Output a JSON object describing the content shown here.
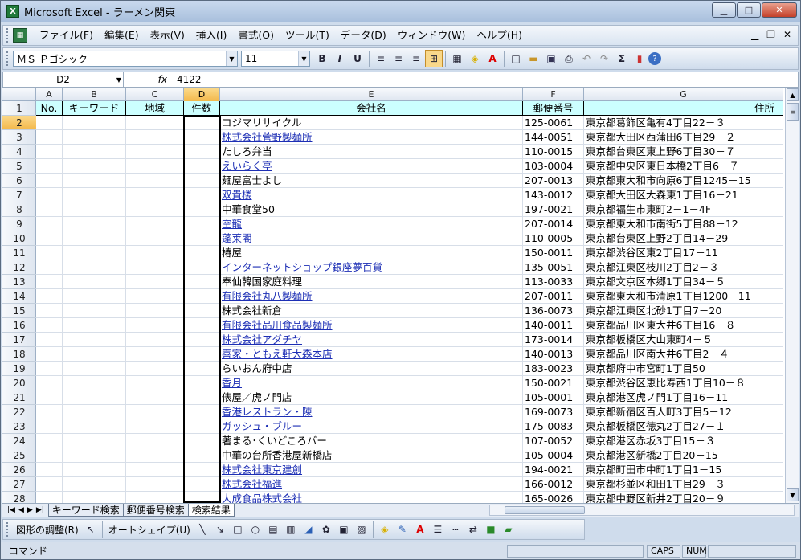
{
  "window": {
    "title": "Microsoft Excel - ラーメン関東"
  },
  "menu": [
    "ファイル(F)",
    "編集(E)",
    "表示(V)",
    "挿入(I)",
    "書式(O)",
    "ツール(T)",
    "データ(D)",
    "ウィンドウ(W)",
    "ヘルプ(H)"
  ],
  "toolbar": {
    "font": "ＭＳ Ｐゴシック",
    "size": "11",
    "bold": "B",
    "italic": "I",
    "underline": "U",
    "sigma": "Σ"
  },
  "formula": {
    "cell_ref": "D2",
    "fx": "fx",
    "value": "4122"
  },
  "columns": [
    "A",
    "B",
    "C",
    "D",
    "E",
    "F",
    "G"
  ],
  "header": {
    "a": "No.",
    "b": "キーワード",
    "c": "地域",
    "d": "件数",
    "e": "会社名",
    "f": "郵便番号",
    "g": "住所"
  },
  "rows": [
    {
      "n": "2",
      "name": "コジマリサイクル",
      "zip": "125-0061",
      "addr": "東京都葛飾区亀有4丁目22－３",
      "link": false
    },
    {
      "n": "3",
      "name": "株式会社菅野製麺所",
      "zip": "144-0051",
      "addr": "東京都大田区西蒲田6丁目29－２",
      "link": true
    },
    {
      "n": "4",
      "name": "たしろ弁当",
      "zip": "110-0015",
      "addr": "東京都台東区東上野6丁目30－７",
      "link": false
    },
    {
      "n": "5",
      "name": "えいらく亭",
      "zip": "103-0004",
      "addr": "東京都中央区東日本橋2丁目6－７",
      "link": true
    },
    {
      "n": "6",
      "name": "麺屋富士よし",
      "zip": "207-0013",
      "addr": "東京都東大和市向原6丁目1245－15",
      "link": false
    },
    {
      "n": "7",
      "name": "双貴楼",
      "zip": "143-0012",
      "addr": "東京都大田区大森東1丁目16－21",
      "link": true
    },
    {
      "n": "8",
      "name": "中華食堂50",
      "zip": "197-0021",
      "addr": "東京都福生市東町2－1－4F",
      "link": false
    },
    {
      "n": "9",
      "name": "空龍",
      "zip": "207-0014",
      "addr": "東京都東大和市南街5丁目88－12",
      "link": true
    },
    {
      "n": "10",
      "name": "蓬莱閣",
      "zip": "110-0005",
      "addr": "東京都台東区上野2丁目14－29",
      "link": true
    },
    {
      "n": "11",
      "name": "椿屋",
      "zip": "150-0011",
      "addr": "東京都渋谷区東2丁目17－11",
      "link": false
    },
    {
      "n": "12",
      "name": "インターネットショップ銀座夢百貨",
      "zip": "135-0051",
      "addr": "東京都江東区枝川2丁目2－３",
      "link": true
    },
    {
      "n": "13",
      "name": "奉仙韓国家庭料理",
      "zip": "113-0033",
      "addr": "東京都文京区本郷1丁目34－５",
      "link": false
    },
    {
      "n": "14",
      "name": "有限会社丸八製麺所",
      "zip": "207-0011",
      "addr": "東京都東大和市清原1丁目1200－11",
      "link": true
    },
    {
      "n": "15",
      "name": "株式会社新倉",
      "zip": "136-0073",
      "addr": "東京都江東区北砂1丁目7－20",
      "link": false
    },
    {
      "n": "16",
      "name": "有限会社品川食品製麺所",
      "zip": "140-0011",
      "addr": "東京都品川区東大井6丁目16－８",
      "link": true
    },
    {
      "n": "17",
      "name": "株式会社アダチヤ",
      "zip": "173-0014",
      "addr": "東京都板橋区大山東町4－５",
      "link": true
    },
    {
      "n": "18",
      "name": "喜家・ともえ軒大森本店",
      "zip": "140-0013",
      "addr": "東京都品川区南大井6丁目2－４",
      "link": true
    },
    {
      "n": "19",
      "name": "らいおん府中店",
      "zip": "183-0023",
      "addr": "東京都府中市宮町1丁目50",
      "link": false
    },
    {
      "n": "20",
      "name": "香月",
      "zip": "150-0021",
      "addr": "東京都渋谷区恵比寿西1丁目10－８",
      "link": true
    },
    {
      "n": "21",
      "name": "俵屋／虎ノ門店",
      "zip": "105-0001",
      "addr": "東京都港区虎ノ門1丁目16－11",
      "link": false
    },
    {
      "n": "22",
      "name": "香港レストラン・陳",
      "zip": "169-0073",
      "addr": "東京都新宿区百人町3丁目5－12",
      "link": true
    },
    {
      "n": "23",
      "name": "ガッシュ・ブルー",
      "zip": "175-0083",
      "addr": "東京都板橋区徳丸2丁目27－１",
      "link": true
    },
    {
      "n": "24",
      "name": "著まる･くいどころバー",
      "zip": "107-0052",
      "addr": "東京都港区赤坂3丁目15－３",
      "link": false
    },
    {
      "n": "25",
      "name": "中華の台所香港屋新橋店",
      "zip": "105-0004",
      "addr": "東京都港区新橋2丁目20－15",
      "link": false
    },
    {
      "n": "26",
      "name": "株式会社東京建創",
      "zip": "194-0021",
      "addr": "東京都町田市中町1丁目1－15",
      "link": true
    },
    {
      "n": "27",
      "name": "株式会社福進",
      "zip": "166-0012",
      "addr": "東京都杉並区和田1丁目29－３",
      "link": true
    },
    {
      "n": "28",
      "name": "大成食品株式会社",
      "zip": "165-0026",
      "addr": "東京都中野区新井2丁目20－９",
      "link": true
    }
  ],
  "tabs": {
    "t1": "キーワード検索",
    "t2": "郵便番号検索",
    "t3": "検索結果"
  },
  "drawbar": {
    "adjust": "図形の調整(R)",
    "autoshape": "オートシェイプ(U)"
  },
  "status": {
    "mode": "コマンド",
    "caps": "CAPS",
    "num": "NUM"
  }
}
